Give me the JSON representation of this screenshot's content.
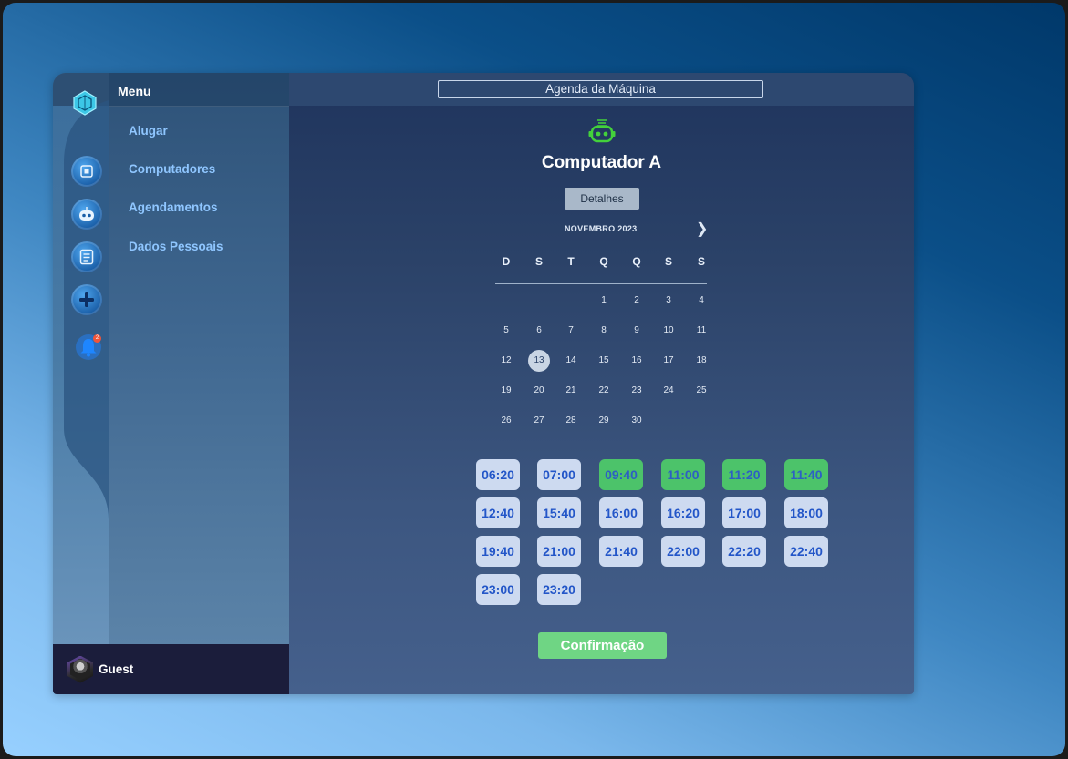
{
  "sidebar": {
    "menu_title": "Menu",
    "items": [
      {
        "label": "Alugar"
      },
      {
        "label": "Computadores"
      },
      {
        "label": "Agendamentos"
      },
      {
        "label": "Dados Pessoais"
      }
    ],
    "notification_count": "2"
  },
  "user": {
    "name": "Guest"
  },
  "header": {
    "title": "Agenda da Máquina"
  },
  "machine": {
    "name": "Computador A",
    "details_label": "Detalhes"
  },
  "calendar": {
    "month_label": "NOVEMBRO 2023",
    "weekdays": [
      "D",
      "S",
      "T",
      "Q",
      "Q",
      "S",
      "S"
    ],
    "selected_day": "13",
    "weeks": [
      [
        "",
        "",
        "",
        "1",
        "2",
        "3",
        "4"
      ],
      [
        "5",
        "6",
        "7",
        "8",
        "9",
        "10",
        "11"
      ],
      [
        "12",
        "13",
        "14",
        "15",
        "16",
        "17",
        "18"
      ],
      [
        "19",
        "20",
        "21",
        "22",
        "23",
        "24",
        "25"
      ],
      [
        "26",
        "27",
        "28",
        "29",
        "30",
        "",
        ""
      ]
    ]
  },
  "time_slots": [
    {
      "time": "06:20",
      "state": "available"
    },
    {
      "time": "07:00",
      "state": "available"
    },
    {
      "time": "09:40",
      "state": "selected"
    },
    {
      "time": "11:00",
      "state": "selected"
    },
    {
      "time": "11:20",
      "state": "selected"
    },
    {
      "time": "11:40",
      "state": "selected"
    },
    {
      "time": "12:40",
      "state": "available"
    },
    {
      "time": "15:40",
      "state": "available"
    },
    {
      "time": "16:00",
      "state": "available"
    },
    {
      "time": "16:20",
      "state": "available"
    },
    {
      "time": "17:00",
      "state": "available"
    },
    {
      "time": "18:00",
      "state": "available"
    },
    {
      "time": "19:40",
      "state": "available"
    },
    {
      "time": "21:00",
      "state": "available"
    },
    {
      "time": "21:40",
      "state": "available"
    },
    {
      "time": "22:00",
      "state": "available"
    },
    {
      "time": "22:20",
      "state": "available"
    },
    {
      "time": "22:40",
      "state": "available"
    },
    {
      "time": "23:00",
      "state": "available"
    },
    {
      "time": "23:20",
      "state": "available"
    }
  ],
  "confirm_label": "Confirmação",
  "colors": {
    "accent_blue": "#2356c8",
    "selected_green": "#4cc36a",
    "confirm_green": "#6fd584",
    "menu_link": "#8fc6ff",
    "user_bar": "#1b1d3b"
  }
}
